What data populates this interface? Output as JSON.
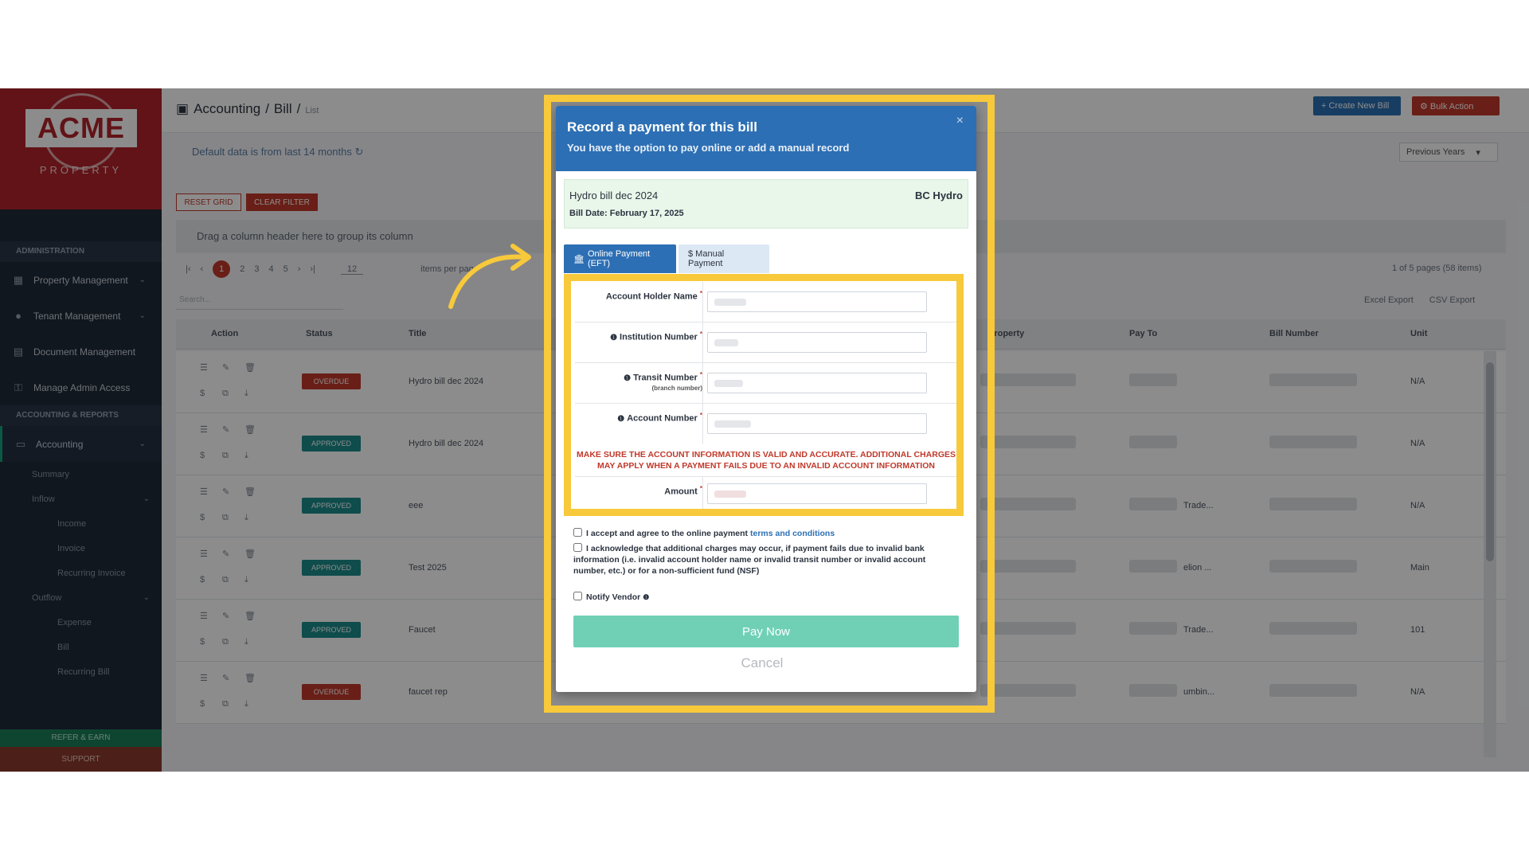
{
  "breadcrumb": {
    "section": "Accounting",
    "sep": "/",
    "page": "Bill",
    "sep2": "/",
    "sub": "List"
  },
  "header_buttons": {
    "create": "+ Create New Bill",
    "bulk": "⚙ Bulk Action"
  },
  "default_note": "Default data is from last 14 months ↻",
  "previous_years": "Previous Years",
  "grid_buttons": {
    "reset": "RESET GRID",
    "clear": "CLEAR FILTER"
  },
  "group_bar": "Drag a column header here to group its column",
  "pager": {
    "first": "|‹",
    "prev": "‹",
    "pages": [
      "1",
      "2",
      "3",
      "4",
      "5"
    ],
    "next": "›",
    "last": "›|",
    "page_size": "12",
    "items_per_page": "items per page",
    "info": "1 of 5 pages (58 items)"
  },
  "search_placeholder": "Search...",
  "exports": {
    "excel": "Excel Export",
    "csv": "CSV Export"
  },
  "columns": {
    "action": "Action",
    "status": "Status",
    "title": "Title",
    "property": "Property",
    "pay_to": "Pay To",
    "bill_number": "Bill Number",
    "unit": "Unit"
  },
  "rows": [
    {
      "status": "OVERDUE",
      "status_kind": "overdue",
      "title": "Hydro bill dec 2024",
      "unit": "N/A",
      "frag": ""
    },
    {
      "status": "APPROVED",
      "status_kind": "approved",
      "title": "Hydro bill dec 2024",
      "unit": "N/A",
      "frag": ""
    },
    {
      "status": "APPROVED",
      "status_kind": "approved",
      "title": "eee",
      "unit": "N/A",
      "frag": "Trade..."
    },
    {
      "status": "APPROVED",
      "status_kind": "approved",
      "title": "Test 2025",
      "unit": "Main",
      "frag": "elion ..."
    },
    {
      "status": "APPROVED",
      "status_kind": "approved",
      "title": "Faucet",
      "unit": "101",
      "frag": "Trade..."
    },
    {
      "status": "OVERDUE",
      "status_kind": "overdue",
      "title": "faucet rep",
      "unit": "N/A",
      "frag": "umbin..."
    }
  ],
  "sidebar": {
    "logo_text": "ACME",
    "logo_sub": "PROPERTY",
    "section_admin": "ADMINISTRATION",
    "admin_items": [
      "Property Management",
      "Tenant Management",
      "Document Management",
      "Manage Admin Access"
    ],
    "section_accounting": "ACCOUNTING & REPORTS",
    "accounting": "Accounting",
    "summary": "Summary",
    "inflow": "Inflow",
    "income": "Income",
    "invoice": "Invoice",
    "recurring_invoice": "Recurring Invoice",
    "outflow": "Outflow",
    "expense": "Expense",
    "bill": "Bill",
    "recurring_bill": "Recurring Bill",
    "refer": "REFER & EARN",
    "support": "SUPPORT"
  },
  "modal": {
    "title": "Record a payment for this bill",
    "subtitle": "You have the option to pay online or add a manual record",
    "close": "×",
    "bill_name": "Hydro bill dec 2024",
    "bill_date": "Bill Date: February 17, 2025",
    "vendor": "BC Hydro",
    "tab_online": "Online Payment (EFT)",
    "tab_manual": "$ Manual Payment",
    "fields": {
      "account_holder": "Account Holder Name",
      "institution": "Institution Number",
      "transit": "Transit Number",
      "transit_hint": "(branch number)",
      "account_number": "Account Number",
      "amount": "Amount"
    },
    "warning_line1": "MAKE SURE THE ACCOUNT INFORMATION IS VALID AND ACCURATE. ADDITIONAL CHARGES",
    "warning_line2": "MAY APPLY WHEN A PAYMENT FAILS DUE TO AN INVALID ACCOUNT INFORMATION",
    "accept_prefix": "I accept and agree to the online payment",
    "accept_link": "terms and conditions",
    "ack_text": "I acknowledge that additional charges may occur, if payment fails due to invalid bank information (i.e. invalid account holder name or invalid transit number or invalid account number, etc.) or for a non-sufficient fund (NSF)",
    "notify": "Notify Vendor",
    "pay_now": "Pay Now",
    "cancel": "Cancel"
  },
  "colors": {
    "accent_blue": "#2d6fb4",
    "highlight_yellow": "#f7c93b",
    "pay_button": "#6fd0b6",
    "warning_red": "#c0392b"
  }
}
